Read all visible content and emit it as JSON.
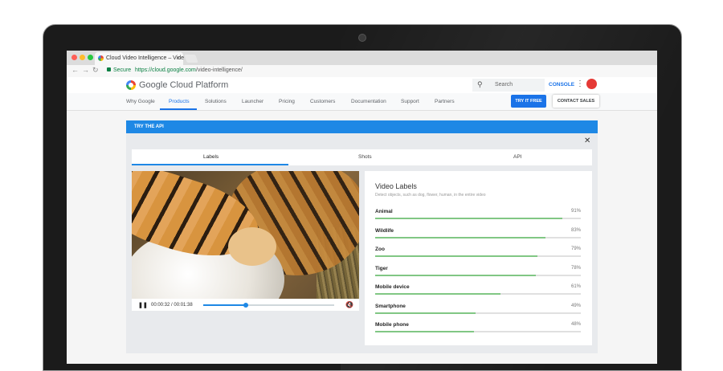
{
  "browser": {
    "tab_title": "Cloud Video Intelligence – Vide",
    "tab_close": "×",
    "secure_label": "Secure",
    "url_scheme_host": "https://cloud.google.com",
    "url_path": "/video-intelligence/",
    "traffic_lights": [
      "#ff5f57",
      "#febc2e",
      "#28c840"
    ]
  },
  "header": {
    "brand": "Google Cloud Platform",
    "search_placeholder": "Search",
    "console_label": "CONSOLE",
    "avatar_color": "#e53935"
  },
  "nav": {
    "items": [
      "Why Google",
      "Products",
      "Solutions",
      "Launcher",
      "Pricing",
      "Customers",
      "Documentation",
      "Support",
      "Partners"
    ],
    "active": "Products",
    "try_label": "TRY IT FREE",
    "sales_label": "CONTACT SALES"
  },
  "panel": {
    "banner": "TRY THE API",
    "close": "✕",
    "tabs": [
      "Labels",
      "Shots",
      "API"
    ],
    "active_tab": "Labels"
  },
  "video": {
    "time": "00:00:32 / 00:01:38",
    "progress_fraction": 0.326
  },
  "labels": {
    "title": "Video Labels",
    "subtitle": "Detect objects, such as dog, flower, human, in the entire video",
    "items": [
      {
        "name": "Animal",
        "pct": "91%",
        "value": 91
      },
      {
        "name": "Wildlife",
        "pct": "83%",
        "value": 83
      },
      {
        "name": "Zoo",
        "pct": "79%",
        "value": 79
      },
      {
        "name": "Tiger",
        "pct": "78%",
        "value": 78
      },
      {
        "name": "Mobile device",
        "pct": "61%",
        "value": 61
      },
      {
        "name": "Smartphone",
        "pct": "49%",
        "value": 49
      },
      {
        "name": "Mobile phone",
        "pct": "48%",
        "value": 48
      }
    ]
  }
}
